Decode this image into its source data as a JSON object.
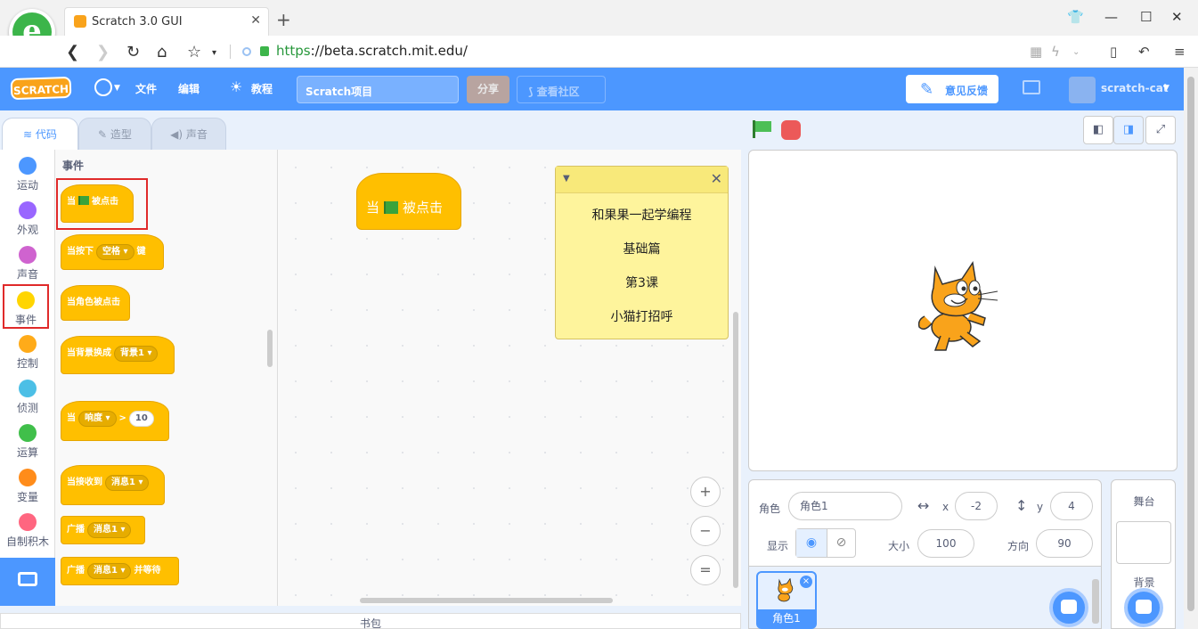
{
  "browser": {
    "tab_title": "Scratch 3.0 GUI",
    "new_tab": "+",
    "url_scheme": "https",
    "url_rest": "://beta.scratch.mit.edu/"
  },
  "menubar": {
    "logo": "SCRATCH",
    "file": "文件",
    "edit": "编辑",
    "tutorials": "教程",
    "project_title": "Scratch项目",
    "share": "分享",
    "see_community": "查看社区",
    "feedback": "意见反馈",
    "username": "scratch-cat"
  },
  "tabs": {
    "code": "代码",
    "costumes": "造型",
    "sounds": "声音"
  },
  "categories": [
    {
      "label": "运动",
      "color": "#4c97ff"
    },
    {
      "label": "外观",
      "color": "#9966ff"
    },
    {
      "label": "声音",
      "color": "#cf63cf"
    },
    {
      "label": "事件",
      "color": "#ffd500"
    },
    {
      "label": "控制",
      "color": "#ffab19"
    },
    {
      "label": "侦测",
      "color": "#4cbfe6"
    },
    {
      "label": "运算",
      "color": "#40bf4a"
    },
    {
      "label": "变量",
      "color": "#ff8c1a"
    },
    {
      "label": "自制积木",
      "color": "#ff6680"
    }
  ],
  "palette": {
    "title": "事件",
    "when_flag": {
      "pre": "当",
      "post": "被点击"
    },
    "when_key": {
      "pre": "当按下",
      "dd": "空格",
      "post": "键"
    },
    "when_sprite_clicked": "当角色被点击",
    "when_backdrop": {
      "pre": "当背景换成",
      "dd": "背景1"
    },
    "when_greater": {
      "pre": "当",
      "dd": "响度",
      "op": ">",
      "val": "10"
    },
    "when_receive": {
      "pre": "当接收到",
      "dd": "消息1"
    },
    "broadcast": {
      "pre": "广播",
      "dd": "消息1"
    },
    "broadcast_wait": {
      "pre": "广播",
      "dd": "消息1",
      "post": "并等待"
    }
  },
  "workspace": {
    "block": {
      "pre": "当",
      "post": "被点击"
    },
    "comment_lines": [
      "和果果一起学编程",
      "基础篇",
      "第3课",
      "小猫打招呼"
    ],
    "zoom_in": "+",
    "zoom_out": "−",
    "zoom_reset": "="
  },
  "backpack": "书包",
  "sprite_info": {
    "sprite_label": "角色",
    "sprite_name": "角色1",
    "x_label": "x",
    "x_value": "-2",
    "y_label": "y",
    "y_value": "4",
    "show_label": "显示",
    "size_label": "大小",
    "size_value": "100",
    "direction_label": "方向",
    "direction_value": "90"
  },
  "sprite_list": {
    "sprite_name": "角色1",
    "delete": "×"
  },
  "stage_panel": {
    "title": "舞台",
    "backdrops_label": "背景"
  }
}
